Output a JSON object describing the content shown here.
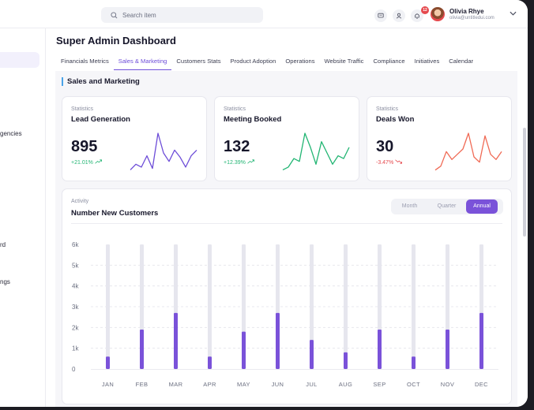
{
  "topbar": {
    "search_placeholder": "Search item",
    "notification_count": "12",
    "user_name": "Olivia Rhye",
    "user_email": "olivia@untitledui.com"
  },
  "sidebar": {
    "items": [
      {
        "label": "gencies"
      },
      {
        "label": "rd"
      },
      {
        "label": "ngs"
      }
    ]
  },
  "page": {
    "title": "Super Admin Dashboard",
    "tabs": [
      {
        "label": "Financials Metrics",
        "active": false
      },
      {
        "label": "Sales &  Marketing",
        "active": true
      },
      {
        "label": "Customers Stats",
        "active": false
      },
      {
        "label": "Product Adoption",
        "active": false
      },
      {
        "label": "Operations",
        "active": false
      },
      {
        "label": "Website Traffic",
        "active": false
      },
      {
        "label": "Compliance",
        "active": false
      },
      {
        "label": "Initiatives",
        "active": false
      },
      {
        "label": "Calendar",
        "active": false
      }
    ]
  },
  "section": {
    "title": "Sales and Marketing"
  },
  "stats": [
    {
      "kicker": "Statistics",
      "title": "Lead Generation",
      "value": "895",
      "delta": "+21.01%",
      "direction": "up",
      "color": "#6d4dd8",
      "spark": [
        2,
        6,
        4,
        12,
        3,
        28,
        14,
        8,
        16,
        11,
        4,
        12,
        16
      ]
    },
    {
      "kicker": "Statistics",
      "title": "Meeting Booked",
      "value": "132",
      "delta": "+12.39%",
      "direction": "up",
      "color": "#22b573",
      "spark": [
        2,
        4,
        10,
        8,
        28,
        18,
        6,
        22,
        14,
        6,
        12,
        10,
        18
      ]
    },
    {
      "kicker": "Statistics",
      "title": "Deals Won",
      "value": "30",
      "delta": "-3.47%",
      "direction": "down",
      "color": "#f06a55",
      "spark": [
        2,
        5,
        16,
        10,
        14,
        18,
        30,
        12,
        8,
        28,
        14,
        10,
        16
      ]
    }
  ],
  "activity": {
    "kicker": "Activity",
    "title": "Number New Customers",
    "periods": [
      "Month",
      "Quarter",
      "Annual"
    ],
    "selected_period": "Annual"
  },
  "colors": {
    "accent": "#7a52d9",
    "bar_bg": "#e6e6ee",
    "up": "#22b573",
    "down": "#e5484d"
  },
  "chart_data": {
    "type": "bar",
    "title": "Number New Customers",
    "categories": [
      "JAN",
      "FEB",
      "MAR",
      "APR",
      "MAY",
      "JUN",
      "JUL",
      "AUG",
      "SEP",
      "OCT",
      "NOV",
      "DEC"
    ],
    "values": [
      600,
      1900,
      2700,
      600,
      1800,
      2700,
      1400,
      800,
      1900,
      600,
      1900,
      2700
    ],
    "capacity": [
      6000,
      6000,
      6000,
      6000,
      6000,
      6000,
      6000,
      6000,
      6000,
      6000,
      6000,
      6000
    ],
    "yticks": [
      "0",
      "1k",
      "2k",
      "3k",
      "4k",
      "5k",
      "6k"
    ],
    "ylim": [
      0,
      6000
    ],
    "grid": true
  }
}
